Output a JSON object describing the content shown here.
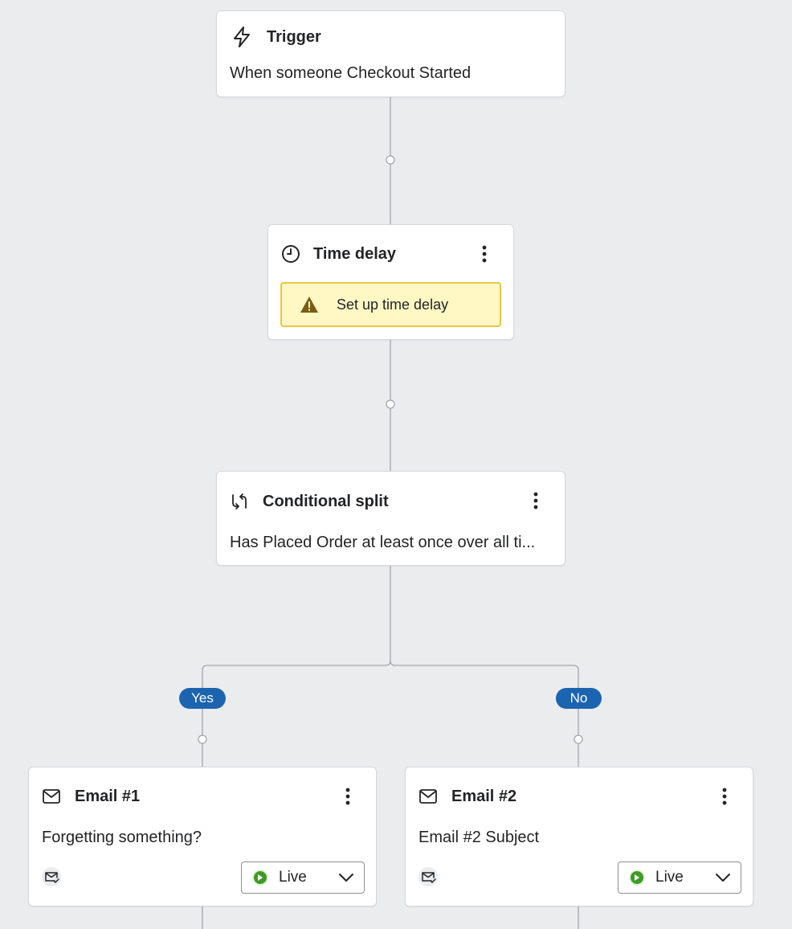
{
  "colors": {
    "canvas_bg": "#ebecee",
    "node_bg": "#ffffff",
    "connector": "#a2a5aa",
    "warning_bg": "#fff8c5",
    "warning_border": "#e9c640",
    "warning_icon": "#7a5c12",
    "branch_badge": "#1d64b0",
    "live_green": "#3f9a29"
  },
  "flow": {
    "trigger": {
      "icon": "lightning-icon",
      "title": "Trigger",
      "description": "When someone Checkout Started"
    },
    "time_delay": {
      "icon": "clock-icon",
      "title": "Time delay",
      "warning": {
        "icon": "warning-icon",
        "text": "Set up time delay"
      }
    },
    "conditional_split": {
      "icon": "split-arrows-icon",
      "title": "Conditional split",
      "description": "Has Placed Order at least once over all ti..."
    },
    "branches": {
      "yes_label": "Yes",
      "no_label": "No"
    },
    "email_1": {
      "icon": "envelope-icon",
      "title": "Email #1",
      "subject": "Forgetting something?",
      "status_icon": "email-check-icon",
      "status": "Live"
    },
    "email_2": {
      "icon": "envelope-icon",
      "title": "Email #2",
      "subject": "Email #2 Subject",
      "status_icon": "email-check-icon",
      "status": "Live"
    }
  }
}
